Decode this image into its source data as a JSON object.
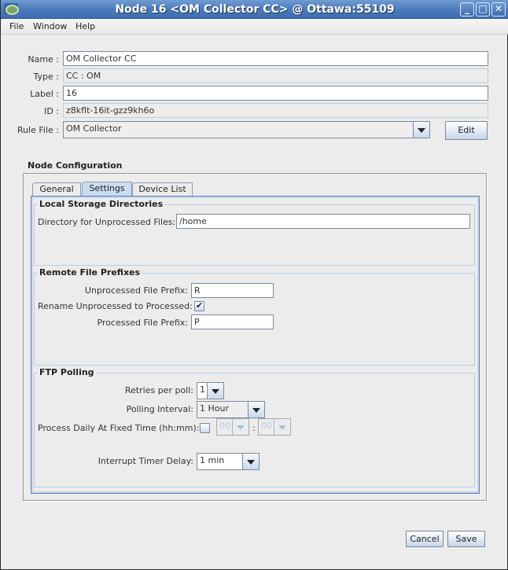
{
  "window": {
    "title": "Node 16 <OM Collector CC> @ Ottawa:55109",
    "controls": {
      "minimize": "_",
      "maximize": "□",
      "close": "✕"
    }
  },
  "menubar": {
    "items": [
      "File",
      "Window",
      "Help"
    ]
  },
  "form": {
    "name_label": "Name :",
    "name_value": "OM Collector CC",
    "type_label": "Type :",
    "type_value": "CC : OM",
    "label_label": "Label :",
    "label_value": "16",
    "id_label": "ID :",
    "id_value": "z8kflt-16it-gzz9kh6o",
    "rule_file_label": "Rule File :",
    "rule_file_value": "OM Collector",
    "edit_button": "Edit"
  },
  "node_config": {
    "title": "Node Configuration",
    "tabs": [
      {
        "label": "General",
        "active": false
      },
      {
        "label": "Settings",
        "active": true
      },
      {
        "label": "Device List",
        "active": false
      }
    ],
    "local_storage": {
      "title": "Local Storage Directories",
      "unprocessed_dir_label": "Directory for Unprocessed Files:",
      "unprocessed_dir_value": "/home"
    },
    "remote_prefixes": {
      "title": "Remote File Prefixes",
      "unprocessed_prefix_label": "Unprocessed File Prefix:",
      "unprocessed_prefix_value": "R",
      "rename_label": "Rename Unprocessed to Processed:",
      "rename_checked": true,
      "processed_prefix_label": "Processed File Prefix:",
      "processed_prefix_value": "P"
    },
    "ftp_polling": {
      "title": "FTP Polling",
      "retries_label": "Retries per poll:",
      "retries_value": "1",
      "interval_label": "Polling Interval:",
      "interval_value": "1 Hour",
      "daily_label": "Process Daily At Fixed Time (hh:mm):",
      "daily_checked": false,
      "daily_hour": "00",
      "daily_sep": ":",
      "daily_minute": "00",
      "interrupt_label": "Interrupt Timer Delay:",
      "interrupt_value": "1 min"
    }
  },
  "footer": {
    "cancel_button": "Cancel",
    "save_button": "Save"
  }
}
